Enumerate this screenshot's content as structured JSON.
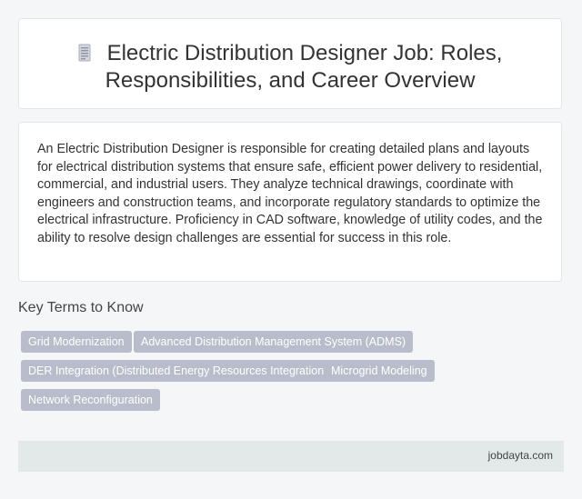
{
  "header": {
    "icon": "document-icon",
    "title_line1": "Electric Distribution Designer Job: Roles,",
    "title_line2": "Responsibilities, and Career Overview"
  },
  "description": "An Electric Distribution Designer is responsible for creating detailed plans and layouts for electrical distribution systems that ensure safe, efficient power delivery to residential, commercial, and industrial users. They analyze technical drawings, coordinate with engineers and construction teams, and incorporate regulatory standards to optimize the electrical infrastructure. Proficiency in CAD software, knowledge of utility codes, and the ability to resolve design challenges are essential for success in this role.",
  "key_terms": {
    "title": "Key Terms to Know",
    "tags": [
      "Grid Modernization",
      "Advanced Distribution Management System (ADMS)",
      "DER Integration (Distributed Energy Resources Integration)",
      "Microgrid Modeling",
      "Network Reconfiguration"
    ]
  },
  "footer": {
    "site": "jobdayta.com"
  },
  "colors": {
    "tag_bg": "#b9bdcb",
    "footer_bg": "#e3e8e8",
    "page_bg": "#f5f6f8"
  }
}
